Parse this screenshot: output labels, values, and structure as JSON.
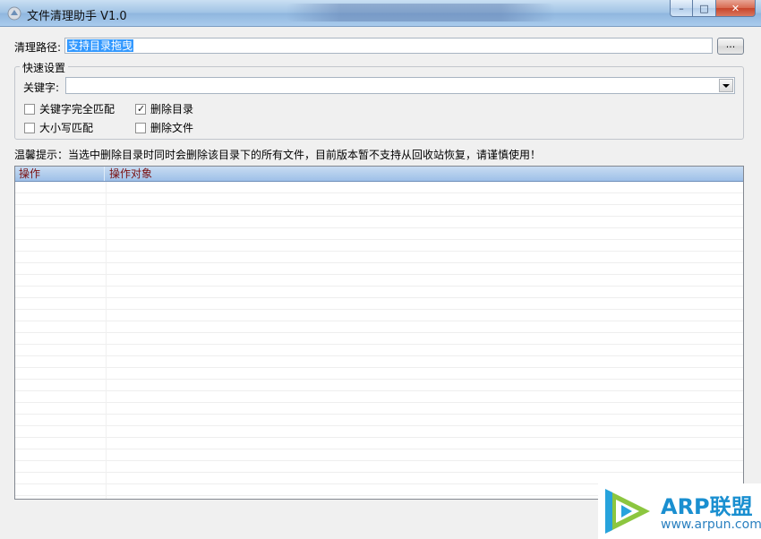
{
  "window": {
    "title": "文件清理助手 V1.0",
    "close_glyph": "✕",
    "max_glyph": "□",
    "min_glyph": "–"
  },
  "path": {
    "label": "清理路径:",
    "value": "支持目录拖曳",
    "browse_label": "..."
  },
  "quick_settings": {
    "legend": "快速设置",
    "keyword_label": "关键字:",
    "keyword_value": "",
    "options": [
      {
        "label": "关键字完全匹配",
        "checked": false
      },
      {
        "label": "删除目录",
        "checked": true
      },
      {
        "label": "大小写匹配",
        "checked": false
      },
      {
        "label": "删除文件",
        "checked": false
      }
    ]
  },
  "hint": "温馨提示：当选中删除目录时同时会删除该目录下的所有文件，目前版本暂不支持从回收站恢复，请谨慎使用！",
  "list": {
    "columns": [
      "操作",
      "操作对象"
    ],
    "rows": []
  },
  "watermark": {
    "name": "ARP联盟",
    "url": "www.arpun.com"
  },
  "colors": {
    "header_text": "#7a1010",
    "selection": "#3399ff",
    "watermark": "#1a8fd0"
  }
}
